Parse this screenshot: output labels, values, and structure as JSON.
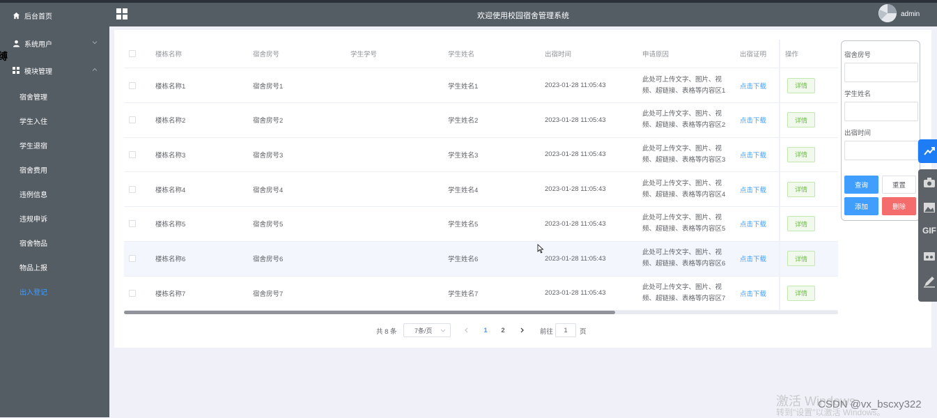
{
  "header": {
    "title": "欢迎使用校园宿舍管理系统",
    "user": "admin"
  },
  "sidebar": {
    "home": "后台首页",
    "system_users": "系统用户",
    "module_mgmt": "模块管理",
    "sub_items": [
      "宿舍管理",
      "学生入住",
      "学生退宿",
      "宿舍费用",
      "违例信息",
      "违规申诉",
      "宿舍物品",
      "物品上报",
      "出入登记"
    ],
    "active_index": 8,
    "cursor_fragment": "缚"
  },
  "table": {
    "columns": [
      "楼栋名称",
      "宿舍房号",
      "学生学号",
      "学生姓名",
      "出宿时间",
      "申请原因",
      "出宿证明",
      "操作"
    ],
    "rows": [
      {
        "building": "楼栋名称1",
        "room": "宿舍房号1",
        "student_no": "",
        "student_name": "学生姓名1",
        "time": "2023-01-28 11:05:43",
        "reason_1": "此处可上传文字、图片、视",
        "reason_2": "频、超链接、表格等内容区1",
        "proof": "点击下载",
        "action": "详情"
      },
      {
        "building": "楼栋名称2",
        "room": "宿舍房号2",
        "student_no": "",
        "student_name": "学生姓名2",
        "time": "2023-01-28 11:05:43",
        "reason_1": "此处可上传文字、图片、视",
        "reason_2": "频、超链接、表格等内容区2",
        "proof": "点击下载",
        "action": "详情"
      },
      {
        "building": "楼栋名称3",
        "room": "宿舍房号3",
        "student_no": "",
        "student_name": "学生姓名3",
        "time": "2023-01-28 11:05:43",
        "reason_1": "此处可上传文字、图片、视",
        "reason_2": "频、超链接、表格等内容区3",
        "proof": "点击下载",
        "action": "详情"
      },
      {
        "building": "楼栋名称4",
        "room": "宿舍房号4",
        "student_no": "",
        "student_name": "学生姓名4",
        "time": "2023-01-28 11:05:43",
        "reason_1": "此处可上传文字、图片、视",
        "reason_2": "频、超链接、表格等内容区4",
        "proof": "点击下载",
        "action": "详情"
      },
      {
        "building": "楼栋名称5",
        "room": "宿舍房号5",
        "student_no": "",
        "student_name": "学生姓名5",
        "time": "2023-01-28 11:05:43",
        "reason_1": "此处可上传文字、图片、视",
        "reason_2": "频、超链接、表格等内容区5",
        "proof": "点击下载",
        "action": "详情"
      },
      {
        "building": "楼栋名称6",
        "room": "宿舍房号6",
        "student_no": "",
        "student_name": "学生姓名6",
        "time": "2023-01-28 11:05:43",
        "reason_1": "此处可上传文字、图片、视",
        "reason_2": "频、超链接、表格等内容区6",
        "proof": "点击下载",
        "action": "详情"
      },
      {
        "building": "楼栋名称7",
        "room": "宿舍房号7",
        "student_no": "",
        "student_name": "学生姓名7",
        "time": "2023-01-28 11:05:43",
        "reason_1": "此处可上传文字、图片、视",
        "reason_2": "频、超链接、表格等内容区7",
        "proof": "点击下载",
        "action": "详情"
      }
    ],
    "hover_row": 5
  },
  "pagination": {
    "total": "共 8 条",
    "page_size": "7条/页",
    "pages": [
      "1",
      "2"
    ],
    "current_page": "1",
    "goto_label": "前往",
    "goto_value": "1",
    "page_suffix": "页"
  },
  "search": {
    "room_label": "宿舍房号",
    "name_label": "学生姓名",
    "time_label": "出宿时间",
    "query": "查询",
    "reset": "重置",
    "add": "添加",
    "delete": "删除"
  },
  "floating_toolbar": {
    "gif_label": "GIF"
  },
  "watermark": {
    "activate_line1": "激活 Windows",
    "activate_line2": "转到\"设置\"以激活 Windows。",
    "csdn": "CSDN @vx_bscxy322"
  },
  "colors": {
    "sidebar_bg": "#545c64",
    "accent": "#409eff",
    "success": "#67c23a",
    "danger": "#f56c6c"
  }
}
